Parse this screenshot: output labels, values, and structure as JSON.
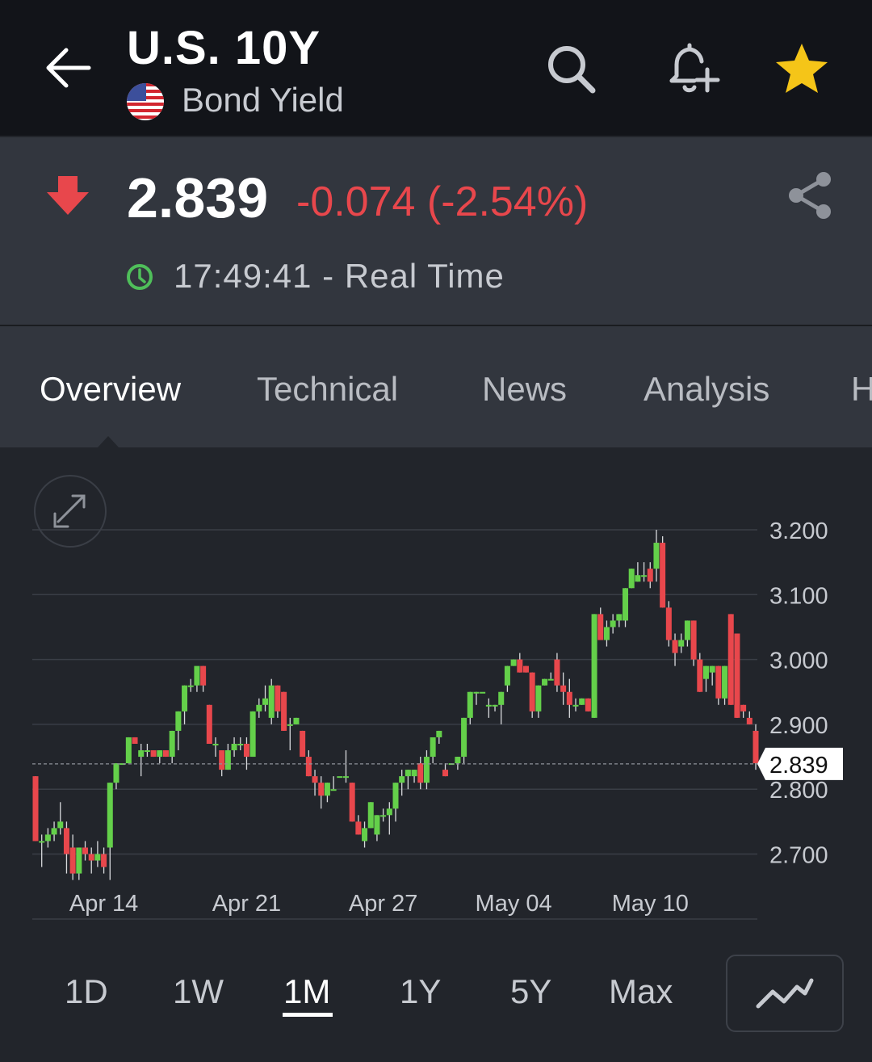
{
  "header": {
    "title": "U.S. 10Y",
    "subtitle": "Bond Yield"
  },
  "quote": {
    "price": "2.839",
    "change": "-0.074 (-2.54%)",
    "time": "17:49:41 - Real Time",
    "colors": {
      "down": "#e8474c",
      "up": "#64d04a",
      "clock": "#4fbf5a",
      "star": "#f5c518"
    }
  },
  "tabs": [
    {
      "label": "Overview",
      "active": true
    },
    {
      "label": "Technical",
      "active": false
    },
    {
      "label": "News",
      "active": false
    },
    {
      "label": "Analysis",
      "active": false
    },
    {
      "label": "H",
      "active": false
    }
  ],
  "ranges": [
    {
      "label": "1D",
      "active": false
    },
    {
      "label": "1W",
      "active": false
    },
    {
      "label": "1M",
      "active": true
    },
    {
      "label": "1Y",
      "active": false
    },
    {
      "label": "5Y",
      "active": false
    },
    {
      "label": "Max",
      "active": false
    }
  ],
  "icons": {
    "back": "arrow-left-icon",
    "search": "search-icon",
    "alert": "bell-plus-icon",
    "favorite": "star-icon",
    "share": "share-icon",
    "expand": "expand-icon",
    "chart_type": "line-chart-icon"
  },
  "chart_data": {
    "type": "candlestick",
    "ylim": [
      2.65,
      3.2
    ],
    "yticks": [
      3.2,
      3.1,
      3.0,
      2.9,
      2.8,
      2.7
    ],
    "ytick_labels": [
      "3.200",
      "3.100",
      "3.000",
      "2.900",
      "2.800",
      "2.700"
    ],
    "xtick_labels": [
      "Apr 14",
      "Apr 21",
      "Apr 27",
      "May 04",
      "May 10"
    ],
    "xtick_index": [
      11,
      34,
      56,
      77,
      99
    ],
    "current_value": 2.839,
    "current_label": "2.839",
    "grid": true,
    "candles": [
      [
        2.82,
        2.82,
        2.72,
        2.72
      ],
      [
        2.72,
        2.73,
        2.68,
        2.72
      ],
      [
        2.72,
        2.74,
        2.71,
        2.73
      ],
      [
        2.73,
        2.75,
        2.72,
        2.74
      ],
      [
        2.74,
        2.78,
        2.73,
        2.75
      ],
      [
        2.74,
        2.75,
        2.67,
        2.7
      ],
      [
        2.71,
        2.73,
        2.66,
        2.67
      ],
      [
        2.67,
        2.71,
        2.66,
        2.71
      ],
      [
        2.71,
        2.72,
        2.69,
        2.7
      ],
      [
        2.7,
        2.71,
        2.67,
        2.69
      ],
      [
        2.69,
        2.72,
        2.68,
        2.7
      ],
      [
        2.7,
        2.71,
        2.67,
        2.68
      ],
      [
        2.71,
        2.81,
        2.66,
        2.81
      ],
      [
        2.81,
        2.84,
        2.8,
        2.84
      ],
      [
        2.84,
        2.84,
        2.84,
        2.84
      ],
      [
        2.84,
        2.88,
        2.84,
        2.88
      ],
      [
        2.88,
        2.88,
        2.87,
        2.87
      ],
      [
        2.85,
        2.87,
        2.82,
        2.86
      ],
      [
        2.86,
        2.87,
        2.85,
        2.86
      ],
      [
        2.86,
        2.86,
        2.85,
        2.85
      ],
      [
        2.85,
        2.86,
        2.84,
        2.86
      ],
      [
        2.86,
        2.86,
        2.85,
        2.85
      ],
      [
        2.85,
        2.89,
        2.84,
        2.89
      ],
      [
        2.89,
        2.92,
        2.86,
        2.92
      ],
      [
        2.92,
        2.96,
        2.9,
        2.96
      ],
      [
        2.96,
        2.97,
        2.95,
        2.96
      ],
      [
        2.96,
        2.98,
        2.95,
        2.99
      ],
      [
        2.99,
        2.99,
        2.95,
        2.96
      ],
      [
        2.93,
        2.93,
        2.87,
        2.87
      ],
      [
        2.87,
        2.88,
        2.85,
        2.87
      ],
      [
        2.86,
        2.86,
        2.82,
        2.83
      ],
      [
        2.83,
        2.87,
        2.83,
        2.86
      ],
      [
        2.86,
        2.88,
        2.85,
        2.87
      ],
      [
        2.87,
        2.88,
        2.86,
        2.87
      ],
      [
        2.87,
        2.88,
        2.83,
        2.85
      ],
      [
        2.85,
        2.92,
        2.85,
        2.92
      ],
      [
        2.92,
        2.94,
        2.91,
        2.93
      ],
      [
        2.93,
        2.96,
        2.92,
        2.94
      ],
      [
        2.91,
        2.97,
        2.9,
        2.96
      ],
      [
        2.96,
        2.96,
        2.91,
        2.92
      ],
      [
        2.95,
        2.95,
        2.89,
        2.89
      ],
      [
        2.9,
        2.91,
        2.86,
        2.9
      ],
      [
        2.9,
        2.91,
        2.9,
        2.91
      ],
      [
        2.89,
        2.89,
        2.85,
        2.85
      ],
      [
        2.85,
        2.86,
        2.82,
        2.82
      ],
      [
        2.82,
        2.83,
        2.79,
        2.81
      ],
      [
        2.81,
        2.82,
        2.77,
        2.79
      ],
      [
        2.79,
        2.81,
        2.78,
        2.81
      ],
      [
        2.8,
        2.82,
        2.8,
        2.8
      ],
      [
        2.82,
        2.82,
        2.82,
        2.82
      ],
      [
        2.82,
        2.86,
        2.81,
        2.82
      ],
      [
        2.81,
        2.81,
        2.75,
        2.75
      ],
      [
        2.75,
        2.76,
        2.73,
        2.73
      ],
      [
        2.72,
        2.75,
        2.71,
        2.74
      ],
      [
        2.74,
        2.78,
        2.74,
        2.78
      ],
      [
        2.73,
        2.76,
        2.72,
        2.76
      ],
      [
        2.76,
        2.77,
        2.75,
        2.76
      ],
      [
        2.76,
        2.78,
        2.73,
        2.77
      ],
      [
        2.77,
        2.81,
        2.75,
        2.81
      ],
      [
        2.81,
        2.83,
        2.79,
        2.82
      ],
      [
        2.82,
        2.83,
        2.8,
        2.83
      ],
      [
        2.82,
        2.83,
        2.81,
        2.83
      ],
      [
        2.84,
        2.85,
        2.8,
        2.81
      ],
      [
        2.81,
        2.86,
        2.8,
        2.85
      ],
      [
        2.85,
        2.87,
        2.84,
        2.88
      ],
      [
        2.88,
        2.89,
        2.87,
        2.89
      ],
      [
        2.83,
        2.84,
        2.82,
        2.82
      ],
      [
        2.84,
        2.84,
        2.84,
        2.84
      ],
      [
        2.84,
        2.85,
        2.83,
        2.85
      ],
      [
        2.85,
        2.91,
        2.84,
        2.91
      ],
      [
        2.91,
        2.95,
        2.9,
        2.95
      ],
      [
        2.95,
        2.95,
        2.93,
        2.95
      ],
      [
        2.95,
        2.95,
        2.95,
        2.95
      ],
      [
        2.93,
        2.94,
        2.91,
        2.93
      ],
      [
        2.93,
        2.93,
        2.92,
        2.93
      ],
      [
        2.93,
        2.95,
        2.9,
        2.95
      ],
      [
        2.96,
        2.99,
        2.95,
        2.99
      ],
      [
        2.99,
        3.0,
        2.99,
        3.0
      ],
      [
        3.0,
        3.01,
        2.98,
        2.98
      ],
      [
        2.99,
        2.99,
        2.98,
        2.98
      ],
      [
        2.98,
        2.98,
        2.91,
        2.92
      ],
      [
        2.92,
        2.96,
        2.91,
        2.96
      ],
      [
        2.96,
        2.97,
        2.96,
        2.97
      ],
      [
        2.97,
        2.98,
        2.97,
        2.97
      ],
      [
        3.0,
        3.01,
        2.95,
        2.96
      ],
      [
        2.96,
        2.98,
        2.93,
        2.95
      ],
      [
        2.95,
        2.97,
        2.91,
        2.93
      ],
      [
        2.93,
        2.94,
        2.92,
        2.93
      ],
      [
        2.93,
        2.94,
        2.93,
        2.94
      ],
      [
        2.94,
        2.94,
        2.92,
        2.92
      ],
      [
        2.91,
        3.07,
        2.91,
        3.07
      ],
      [
        3.07,
        3.08,
        3.03,
        3.03
      ],
      [
        3.03,
        3.06,
        3.02,
        3.05
      ],
      [
        3.05,
        3.07,
        3.04,
        3.06
      ],
      [
        3.06,
        3.07,
        3.05,
        3.07
      ],
      [
        3.06,
        3.11,
        3.05,
        3.11
      ],
      [
        3.11,
        3.14,
        3.11,
        3.14
      ],
      [
        3.12,
        3.15,
        3.12,
        3.13
      ],
      [
        3.13,
        3.15,
        3.12,
        3.13
      ],
      [
        3.14,
        3.15,
        3.11,
        3.12
      ],
      [
        3.14,
        3.2,
        3.12,
        3.18
      ],
      [
        3.18,
        3.19,
        3.08,
        3.08
      ],
      [
        3.08,
        3.09,
        3.02,
        3.03
      ],
      [
        3.03,
        3.04,
        2.99,
        3.01
      ],
      [
        3.02,
        3.04,
        3.01,
        3.03
      ],
      [
        3.03,
        3.06,
        3.02,
        3.06
      ],
      [
        3.06,
        3.06,
        2.99,
        3.0
      ],
      [
        3.0,
        3.01,
        2.95,
        2.95
      ],
      [
        2.97,
        2.99,
        2.95,
        2.99
      ],
      [
        2.98,
        2.99,
        2.96,
        2.99
      ],
      [
        2.99,
        2.99,
        2.93,
        2.94
      ],
      [
        2.94,
        2.99,
        2.93,
        2.99
      ],
      [
        3.07,
        3.07,
        2.93,
        2.93
      ],
      [
        3.04,
        3.04,
        2.91,
        2.91
      ],
      [
        2.93,
        2.93,
        2.91,
        2.92
      ],
      [
        2.91,
        2.92,
        2.9,
        2.9
      ],
      [
        2.89,
        2.9,
        2.83,
        2.84
      ]
    ]
  }
}
